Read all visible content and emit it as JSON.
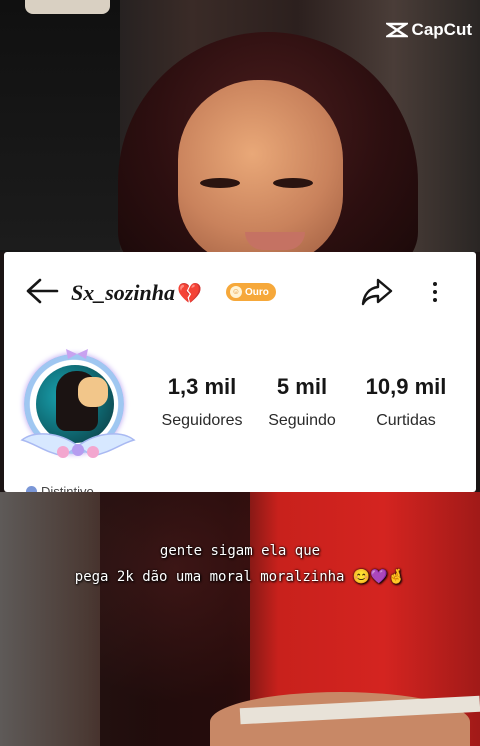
{
  "watermark": {
    "brand": "CapCut"
  },
  "profile": {
    "username": "Sx_sozinha",
    "username_emoji": "💔",
    "badge_label": "Ouro",
    "stats": [
      {
        "value": "1,3 mil",
        "label": "Seguidores"
      },
      {
        "value": "5 mil",
        "label": "Seguindo"
      },
      {
        "value": "10,9 mil",
        "label": "Curtidas"
      }
    ],
    "distintivo_label": "Distintivo"
  },
  "caption": {
    "line1": "gente sigam ela que",
    "line2": "pega 2k dão uma moral moralzinha 😊💜🤞"
  },
  "icons": [
    "back-arrow-icon",
    "share-icon",
    "more-options-icon",
    "coin-icon",
    "capcut-logo-icon",
    "distintivo-icon"
  ],
  "colors": {
    "badge": "#f6a83a",
    "heart": "#ee4a92",
    "card_bg": "#ffffff"
  }
}
